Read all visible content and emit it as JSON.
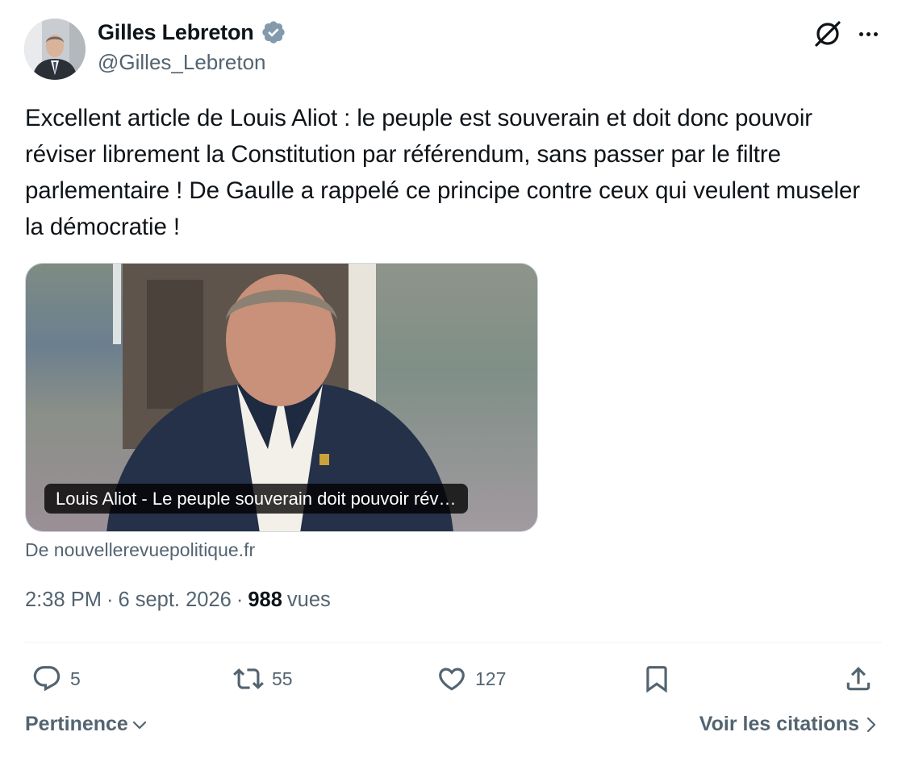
{
  "author": {
    "display_name": "Gilles Lebreton",
    "handle": "@Gilles_Lebreton",
    "verified_color": "#829aab",
    "avatar_icon": "avatar-photo"
  },
  "header_actions": {
    "grok_icon": "grok-icon",
    "more_icon": "more-icon"
  },
  "tweet": {
    "text": "Excellent article de Louis Aliot : le peuple est souverain et doit donc pouvoir réviser librement la Constitution par référendum, sans passer par le filtre parlementaire ! De Gaulle a rappelé ce principe contre ceux qui veulent museler la démocratie !"
  },
  "link_card": {
    "caption": "Louis Aliot - Le peuple souverain doit pouvoir rév…",
    "source": "De nouvellerevuepolitique.fr"
  },
  "meta": {
    "time": "2:38 PM",
    "separator": "·",
    "date": "6 sept. 2026",
    "separator2": "·",
    "views_count": "988",
    "views_label": "vues"
  },
  "actions": {
    "reply_count": "5",
    "retweet_count": "55",
    "like_count": "127",
    "bookmark_icon": "bookmark-icon",
    "share_icon": "share-icon"
  },
  "footer": {
    "sort_label": "Pertinence",
    "quotes_label": "Voir les citations"
  },
  "colors": {
    "text_primary": "#0f1419",
    "text_secondary": "#536471",
    "divider": "#eff3f4"
  }
}
